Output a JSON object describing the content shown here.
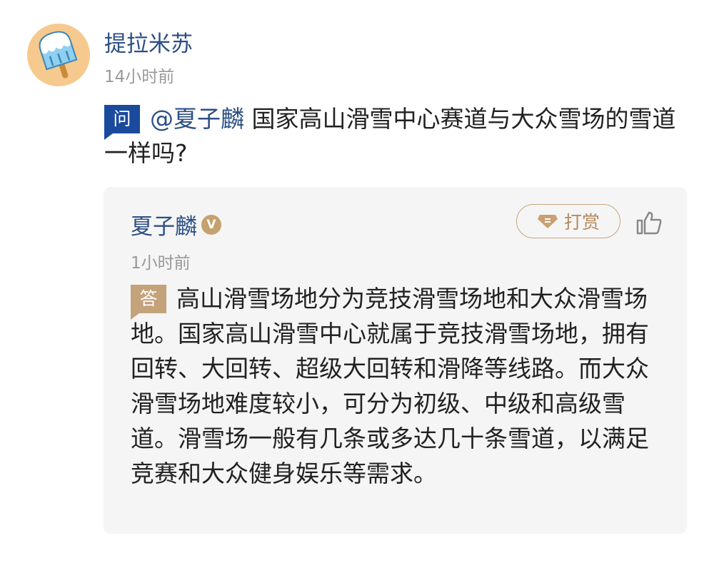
{
  "post": {
    "author": "提拉米苏",
    "time": "14小时前",
    "avatar_icon": "popsicle-icon"
  },
  "question": {
    "badge": "问",
    "mention": "@夏子麟",
    "text": "国家高山滑雪中心赛道与大众雪场的雪道一样吗?"
  },
  "answer": {
    "author": "夏子麟",
    "verified_badge": "V",
    "time": "1小时前",
    "tip_label": "打赏",
    "tip_icon": "diamond-icon",
    "like_icon": "thumbs-up-icon",
    "badge": "答",
    "text": "高山滑雪场地分为竞技滑雪场地和大众滑雪场地。国家高山滑雪中心就属于竞技滑雪场地，拥有回转、大回转、超级大回转和滑降等线路。而大众滑雪场地难度较小，可分为初级、中级和高级雪道。滑雪场一般有几条或多达几十条雪道，以满足竞赛和大众健身娱乐等需求。"
  },
  "colors": {
    "name_blue": "#2d4f85",
    "question_badge": "#1a4a9c",
    "answer_badge": "#c4a27a",
    "avatar_bg": "#f6c98e",
    "card_bg": "#f5f5f5"
  }
}
